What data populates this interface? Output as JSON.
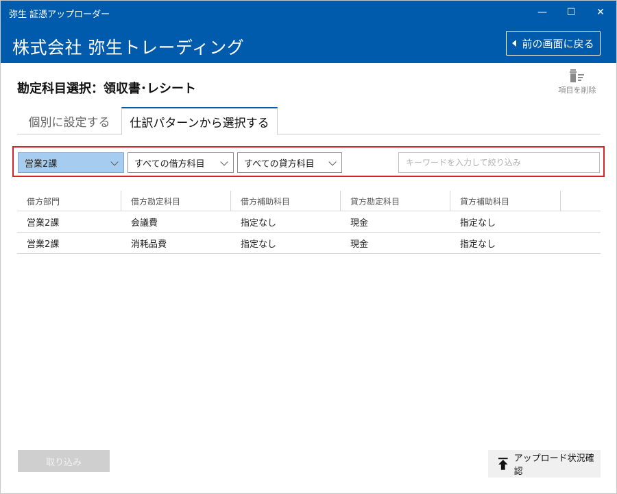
{
  "window": {
    "app_title": "弥生 証憑アップローダー",
    "controls": {
      "minimize": "—",
      "maximize": "☐",
      "close": "✕"
    }
  },
  "header": {
    "company_name": "株式会社 弥生トレーディング",
    "back_label": "前の画面に戻る"
  },
  "page": {
    "title": "勘定科目選択：領収書･レシート",
    "delete_items_label": "項目を削除"
  },
  "tabs": [
    {
      "label": "個別に設定する",
      "active": false
    },
    {
      "label": "仕訳パターンから選択する",
      "active": true
    }
  ],
  "filters": {
    "department": "営業2課",
    "debit_account": "すべての借方科目",
    "credit_account": "すべての貸方科目",
    "keyword_placeholder": "キーワードを入力して絞り込み"
  },
  "table": {
    "columns": [
      "借方部門",
      "借方勘定科目",
      "借方補助科目",
      "貸方勘定科目",
      "貸方補助科目"
    ],
    "rows": [
      [
        "営業2課",
        "会議費",
        "指定なし",
        "現金",
        "指定なし"
      ],
      [
        "営業2課",
        "消耗品費",
        "指定なし",
        "現金",
        "指定なし"
      ]
    ]
  },
  "footer": {
    "import_label": "取り込み",
    "upload_status_label": "アップロード状況確認"
  },
  "colors": {
    "brand_blue": "#005bac",
    "highlight_red": "#d9232b",
    "selected_filter": "#a6cdef"
  }
}
